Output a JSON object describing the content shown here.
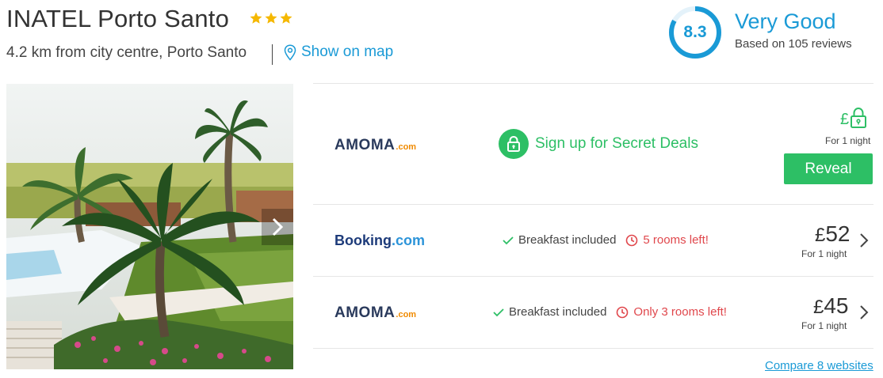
{
  "hotel": {
    "name": "INATEL Porto Santo",
    "star_count": 3,
    "location": "4.2 km from city centre, Porto Santo",
    "map_link": "Show on map"
  },
  "rating": {
    "score": "8.3",
    "fraction": 0.83,
    "label": "Very Good",
    "reviews": "Based on 105 reviews"
  },
  "deals": [
    {
      "provider_name": "AMOMA",
      "provider_suffix": ".com",
      "secret_label": "Sign up for Secret Deals",
      "currency": "£",
      "per_night": "For 1 night",
      "button": "Reveal"
    },
    {
      "provider_name": "Booking",
      "provider_suffix": ".com",
      "breakfast": "Breakfast included",
      "availability": "5 rooms left!",
      "currency": "£",
      "price": "52",
      "per_night": "For 1 night"
    },
    {
      "provider_name": "AMOMA",
      "provider_suffix": ".com",
      "breakfast": "Breakfast included",
      "availability": "Only 3 rooms left!",
      "currency": "£",
      "price": "45",
      "per_night": "For 1 night"
    }
  ],
  "compare_link": "Compare 8 websites",
  "colors": {
    "brand_blue": "#1a9ad6",
    "deal_green": "#2dbf65",
    "warning_red": "#e0474c",
    "star_gold": "#f5b800"
  },
  "icons": [
    "star-icon",
    "map-pin-icon",
    "lock-icon",
    "check-icon",
    "clock-icon",
    "chevron-right-icon"
  ]
}
